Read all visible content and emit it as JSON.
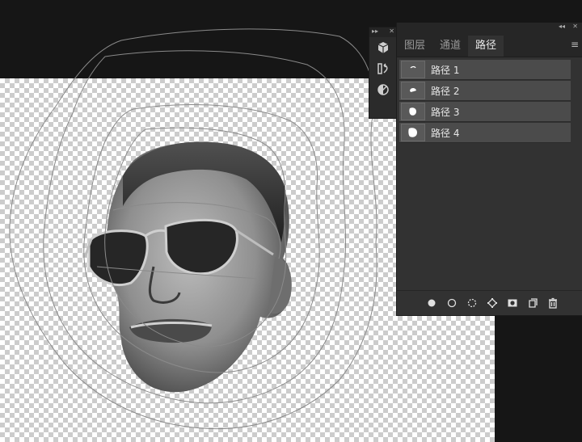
{
  "panel": {
    "tabs": [
      "图层",
      "通道",
      "路径"
    ],
    "active_tab_index": 2,
    "paths": [
      {
        "name": "路径 1",
        "thumb_icon": "path-thumbnail-icon"
      },
      {
        "name": "路径 2",
        "thumb_icon": "path-thumbnail-icon"
      },
      {
        "name": "路径 3",
        "thumb_icon": "path-thumbnail-icon"
      },
      {
        "name": "路径 4",
        "thumb_icon": "path-thumbnail-icon"
      }
    ],
    "footer_icons": [
      "fill-path-icon",
      "stroke-path-icon",
      "load-path-as-selection-icon",
      "make-work-path-icon",
      "add-mask-icon",
      "create-new-path-icon",
      "delete-path-icon"
    ]
  },
  "tool_strip": {
    "icons": [
      "3d-cube-icon",
      "history-brush-icon",
      "adjustment-icon"
    ]
  },
  "colors": {
    "app_background": "#161616",
    "panel_background": "#323232",
    "panel_tab_bar": "#262626",
    "path_row": "#4b4b4b",
    "path_outline": "#8a8a8a"
  }
}
